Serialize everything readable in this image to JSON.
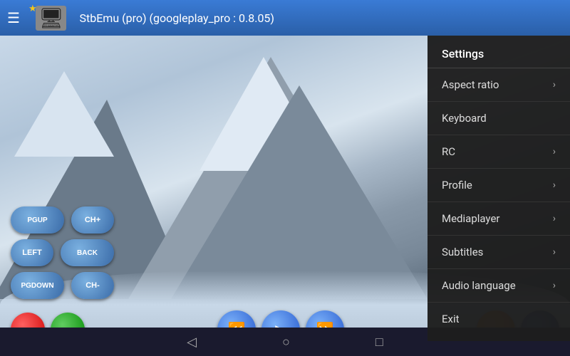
{
  "topbar": {
    "title": "StbEmu (pro) (googleplay_pro : 0.8.05)",
    "hamburger": "☰",
    "star": "★"
  },
  "controls": {
    "row1": [
      "PGUP",
      "CH+"
    ],
    "row2": [
      "LEFT",
      "BACK"
    ],
    "row3": [
      "PGDOWN",
      "CH-"
    ]
  },
  "transport": {
    "rewind": "⏪",
    "play": "▶",
    "forward": "⏩"
  },
  "navbar": {
    "back": "◁",
    "home": "○",
    "square": "□"
  },
  "menu": {
    "title": "Settings",
    "items": [
      {
        "label": "Aspect ratio",
        "hasArrow": true
      },
      {
        "label": "Keyboard",
        "hasArrow": false
      },
      {
        "label": "RC",
        "hasArrow": true
      },
      {
        "label": "Profile",
        "hasArrow": true
      },
      {
        "label": "Mediaplayer",
        "hasArrow": true
      },
      {
        "label": "Subtitles",
        "hasArrow": true
      },
      {
        "label": "Audio language",
        "hasArrow": true
      },
      {
        "label": "Exit",
        "hasArrow": false
      }
    ]
  }
}
